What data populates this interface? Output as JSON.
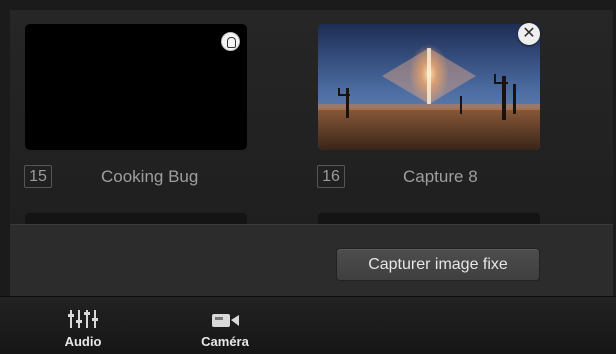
{
  "media_pool": {
    "items": [
      {
        "index": "15",
        "name": "Cooking Bug",
        "icon": "audio-badge-icon"
      },
      {
        "index": "16",
        "name": "Capture 8",
        "icon": "remove-icon",
        "remove_glyph": "✕"
      }
    ]
  },
  "actions": {
    "capture_label": "Capturer image fixe"
  },
  "tabs": [
    {
      "label": "Audio",
      "icon": "mixer-sliders-icon"
    },
    {
      "label": "Caméra",
      "icon": "camera-icon"
    }
  ]
}
